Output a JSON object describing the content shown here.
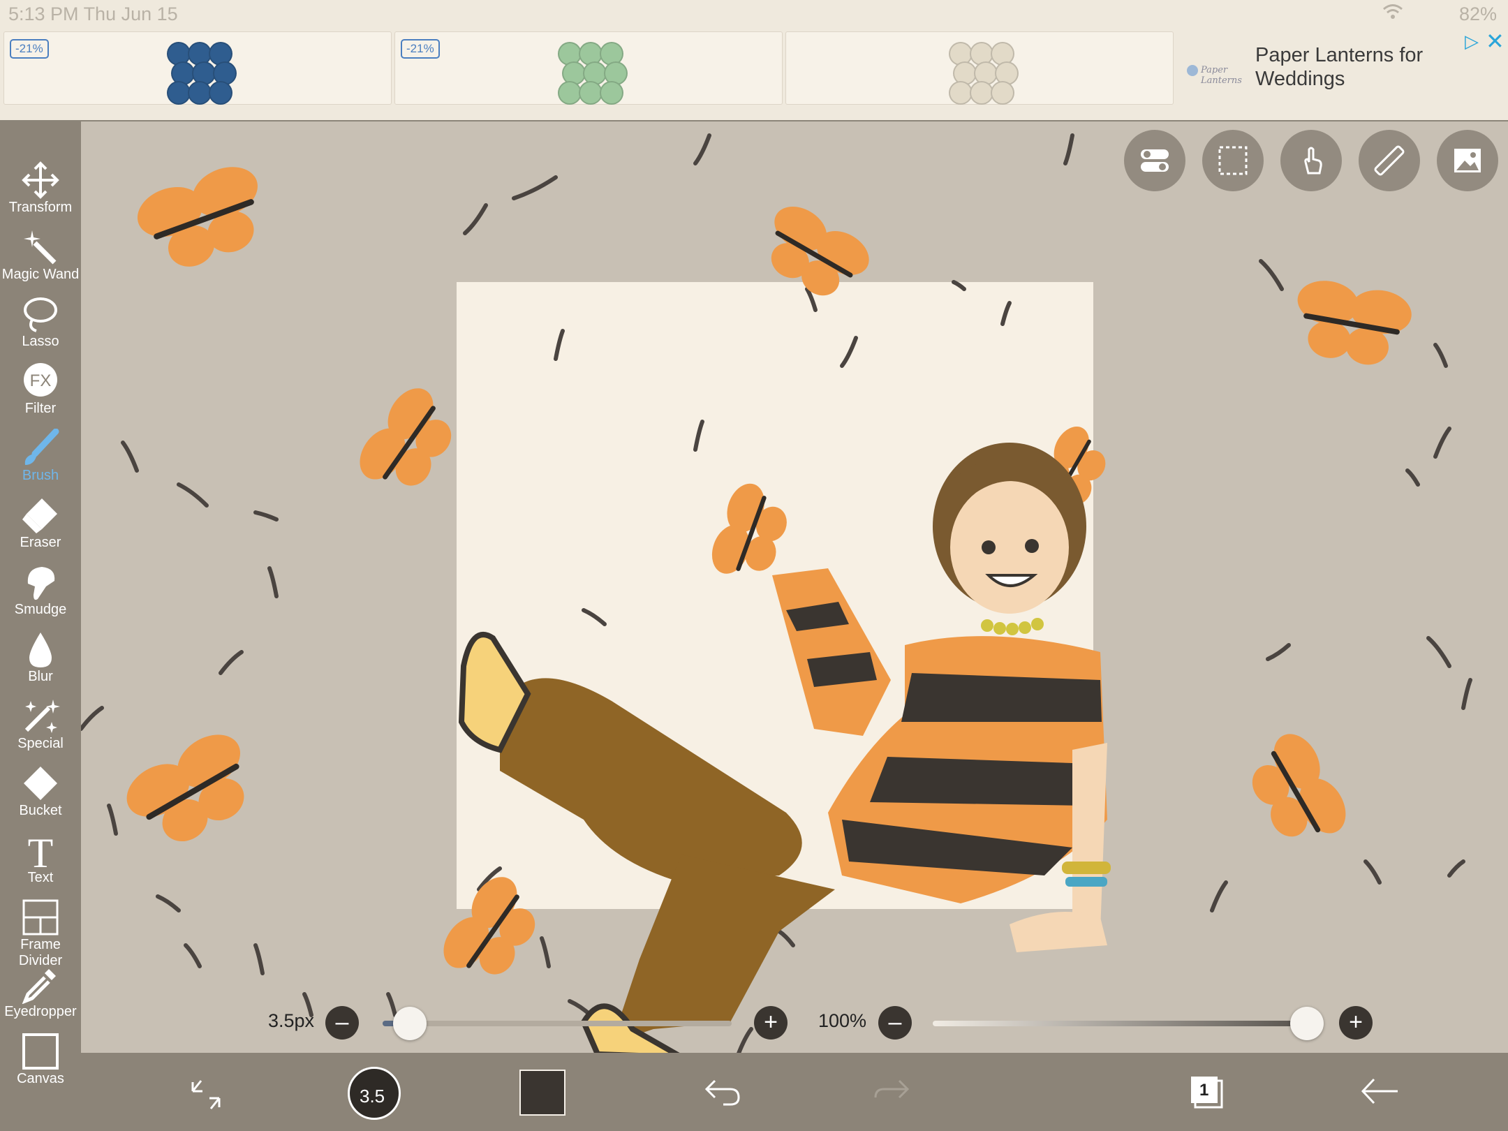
{
  "status_bar": {
    "time": "5:13 PM   Thu Jun 15",
    "battery": "82%"
  },
  "ad": {
    "tiles": [
      {
        "badge": "-21%",
        "lantern_color": "#2f5d8f"
      },
      {
        "badge": "-21%",
        "lantern_color": "#9cc79c"
      },
      {
        "badge": "",
        "lantern_color": "#e2dac8"
      }
    ],
    "brand": "Paper Lanterns",
    "title": "Paper Lanterns for Weddings"
  },
  "tools": [
    {
      "label": "Transform",
      "icon": "move-arrows-icon"
    },
    {
      "label": "Magic Wand",
      "icon": "magic-wand-icon"
    },
    {
      "label": "Lasso",
      "icon": "lasso-icon"
    },
    {
      "label": "Filter",
      "icon": "fx-icon"
    },
    {
      "label": "Brush",
      "icon": "brush-icon",
      "active": true
    },
    {
      "label": "Eraser",
      "icon": "eraser-icon"
    },
    {
      "label": "Smudge",
      "icon": "smudge-icon"
    },
    {
      "label": "Blur",
      "icon": "drop-icon"
    },
    {
      "label": "Special",
      "icon": "sparkle-icon"
    },
    {
      "label": "Bucket",
      "icon": "bucket-icon"
    },
    {
      "label": "Text",
      "icon": "text-icon"
    },
    {
      "label": "Frame Divider",
      "icon": "frame-divider-icon"
    },
    {
      "label": "Eyedropper",
      "icon": "eyedropper-icon"
    },
    {
      "label": "Canvas",
      "icon": "canvas-icon"
    }
  ],
  "top_buttons": [
    "toggle-icon",
    "selection-icon",
    "touch-icon",
    "ruler-icon",
    "image-icon"
  ],
  "brush_size": {
    "label": "3.5px",
    "level": 0.03
  },
  "opacity": {
    "label": "100%",
    "level": 1.0
  },
  "bottom_bar": {
    "brush_size_badge": "3.5",
    "current_color": "#3a3530",
    "layer_count": "1"
  },
  "colors": {
    "toolbar": "#8c8478",
    "workspace": "#c8c0b4",
    "active_tool": "#6fb6ea",
    "paper": "#f7f0e4",
    "butterfly": "#ef9a48"
  }
}
